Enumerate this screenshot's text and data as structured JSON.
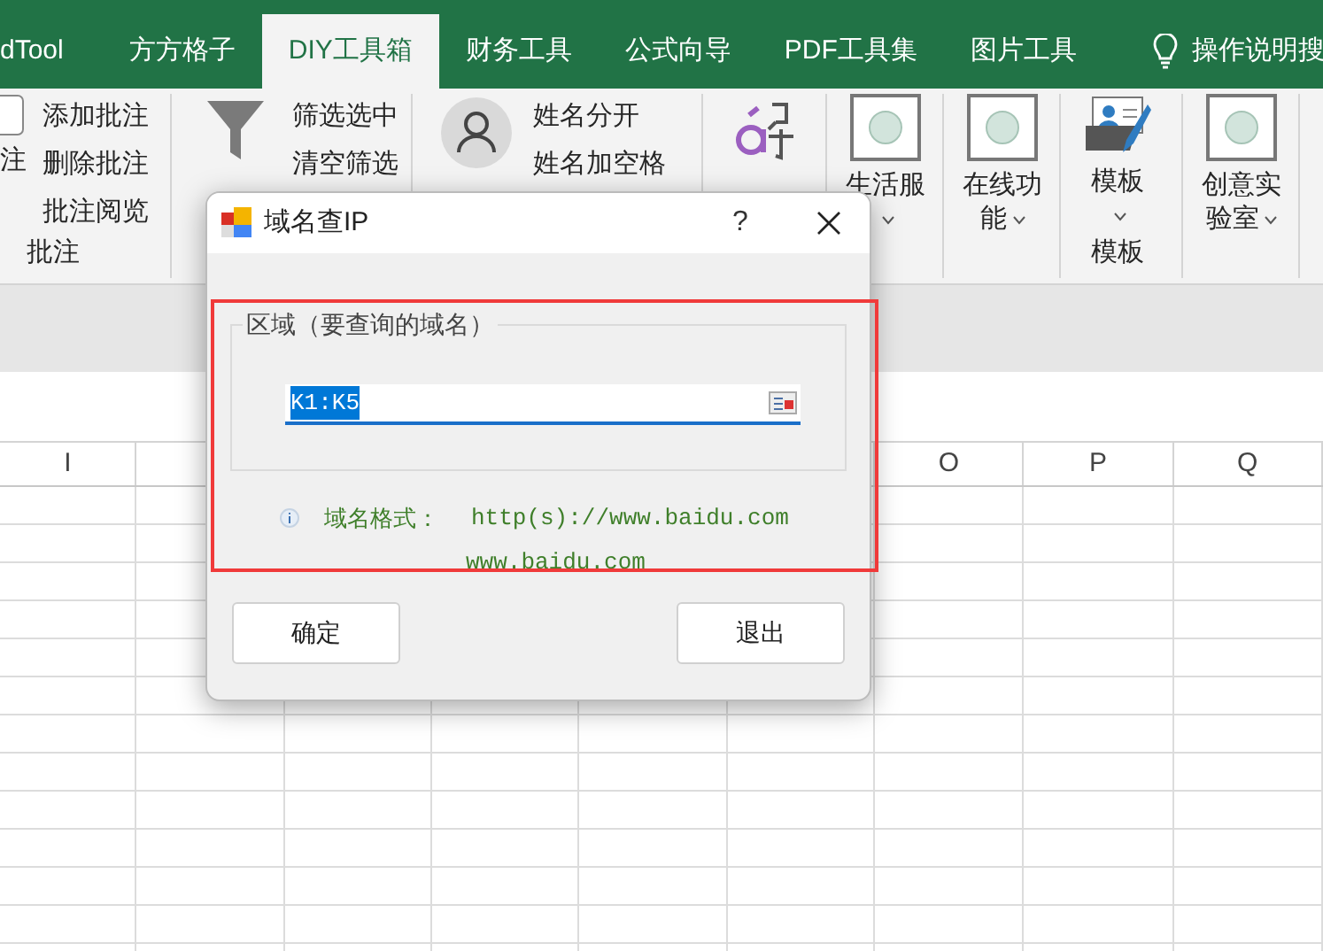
{
  "tabs": [
    {
      "label": "dTool",
      "selected": false
    },
    {
      "label": "方方格子",
      "selected": false
    },
    {
      "label": "DIY工具箱",
      "selected": true
    },
    {
      "label": "财务工具",
      "selected": false
    },
    {
      "label": "公式向导",
      "selected": false
    },
    {
      "label": "PDF工具集",
      "selected": false
    },
    {
      "label": "图片工具",
      "selected": false
    }
  ],
  "search_hint": "操作说明搜",
  "ribbon": {
    "groups": [
      {
        "label": "批注",
        "items": [
          {
            "kind": "checkbox",
            "label": "注"
          },
          {
            "kind": "stack",
            "entries": [
              "添加批注",
              "删除批注",
              "批注阅览"
            ]
          }
        ]
      },
      {
        "items": [
          {
            "kind": "funnel"
          },
          {
            "kind": "stack",
            "entries": [
              "筛选选中",
              "清空筛选"
            ]
          }
        ]
      },
      {
        "items": [
          {
            "kind": "person"
          },
          {
            "kind": "stack",
            "entries": [
              "姓名分开",
              "姓名加空格"
            ]
          }
        ]
      },
      {
        "items": [
          {
            "kind": "pinyin"
          }
        ]
      },
      {
        "items": [
          {
            "kind": "app",
            "label": "生活服",
            "dropdown": true
          }
        ]
      },
      {
        "items": [
          {
            "kind": "app",
            "label": "在线功能",
            "dropdown": true
          }
        ]
      },
      {
        "label": "模板",
        "items": [
          {
            "kind": "template",
            "label": "模板",
            "dropdown": true
          }
        ]
      },
      {
        "items": [
          {
            "kind": "app",
            "label": "创意实验室",
            "dropdown": true
          }
        ]
      }
    ]
  },
  "column_headers": [
    "I",
    "O",
    "P",
    "Q"
  ],
  "dialog": {
    "title": "域名查IP",
    "help": "?",
    "legend": "区域（要查询的域名）",
    "range_value": "K1:K5",
    "value_selected": true,
    "format_label": "域名格式：",
    "format_example_1": "http(s)://www.baidu.com",
    "format_example_2": "www.baidu.com",
    "buttons": [
      "确定",
      "退出"
    ]
  }
}
